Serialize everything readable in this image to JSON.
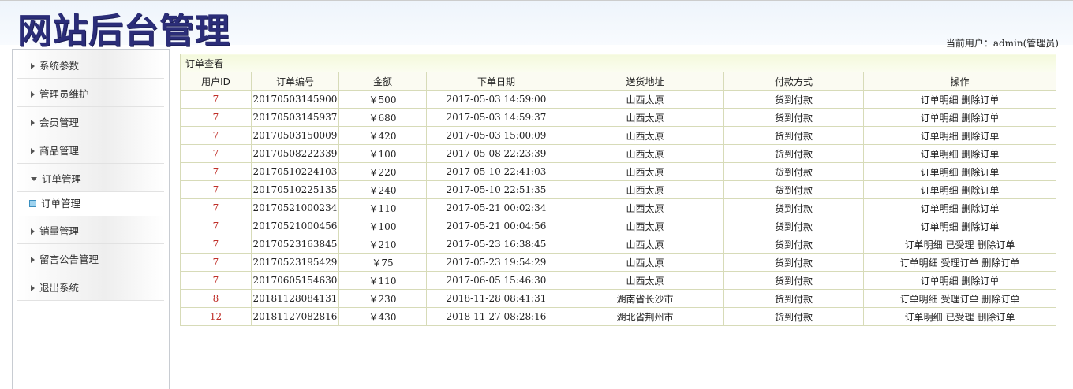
{
  "header": {
    "logo": "网站后台管理",
    "current_user": "当前用户：admin(管理员)"
  },
  "sidebar": {
    "items": [
      "系统参数",
      "管理员维护",
      "会员管理",
      "商品管理",
      "订单管理",
      "销量管理",
      "留言公告管理",
      "退出系统"
    ],
    "sub_item": "订单管理"
  },
  "table": {
    "caption": "订单查看",
    "headers": [
      "用户ID",
      "订单编号",
      "金额",
      "下单日期",
      "送货地址",
      "付款方式",
      "操作"
    ],
    "rows": [
      [
        "7",
        "20170503145900",
        "￥500",
        "2017-05-03 14:59:00",
        "山西太原",
        "货到付款",
        [
          "订单明细",
          "删除订单"
        ]
      ],
      [
        "7",
        "20170503145937",
        "￥680",
        "2017-05-03 14:59:37",
        "山西太原",
        "货到付款",
        [
          "订单明细",
          "删除订单"
        ]
      ],
      [
        "7",
        "20170503150009",
        "￥420",
        "2017-05-03 15:00:09",
        "山西太原",
        "货到付款",
        [
          "订单明细",
          "删除订单"
        ]
      ],
      [
        "7",
        "20170508222339",
        "￥100",
        "2017-05-08 22:23:39",
        "山西太原",
        "货到付款",
        [
          "订单明细",
          "删除订单"
        ]
      ],
      [
        "7",
        "20170510224103",
        "￥220",
        "2017-05-10 22:41:03",
        "山西太原",
        "货到付款",
        [
          "订单明细",
          "删除订单"
        ]
      ],
      [
        "7",
        "20170510225135",
        "￥240",
        "2017-05-10 22:51:35",
        "山西太原",
        "货到付款",
        [
          "订单明细",
          "删除订单"
        ]
      ],
      [
        "7",
        "20170521000234",
        "￥110",
        "2017-05-21 00:02:34",
        "山西太原",
        "货到付款",
        [
          "订单明细",
          "删除订单"
        ]
      ],
      [
        "7",
        "20170521000456",
        "￥100",
        "2017-05-21 00:04:56",
        "山西太原",
        "货到付款",
        [
          "订单明细",
          "删除订单"
        ]
      ],
      [
        "7",
        "20170523163845",
        "￥210",
        "2017-05-23 16:38:45",
        "山西太原",
        "货到付款",
        [
          "订单明细",
          "已受理",
          "删除订单"
        ]
      ],
      [
        "7",
        "20170523195429",
        "￥75",
        "2017-05-23 19:54:29",
        "山西太原",
        "货到付款",
        [
          "订单明细",
          "受理订单",
          "删除订单"
        ]
      ],
      [
        "7",
        "20170605154630",
        "￥110",
        "2017-06-05 15:46:30",
        "山西太原",
        "货到付款",
        [
          "订单明细",
          "删除订单"
        ]
      ],
      [
        "8",
        "20181128084131",
        "￥230",
        "2018-11-28 08:41:31",
        "湖南省长沙市",
        "货到付款",
        [
          "订单明细",
          "受理订单",
          "删除订单"
        ]
      ],
      [
        "12",
        "20181127082816",
        "￥430",
        "2018-11-27 08:28:16",
        "湖北省荆州市",
        "货到付款",
        [
          "订单明细",
          "已受理",
          "删除订单"
        ]
      ]
    ]
  }
}
